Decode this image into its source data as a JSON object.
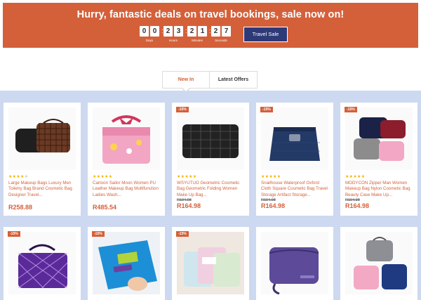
{
  "banner": {
    "title": "Hurry, fantastic deals on travel bookings, sale now on!",
    "countdown": {
      "days": [
        "0",
        "0"
      ],
      "hours": [
        "2",
        "3"
      ],
      "minutes": [
        "2",
        "1"
      ],
      "seconds": [
        "2",
        "7"
      ],
      "labels": {
        "days": "Days",
        "hours": "Hours",
        "minutes": "Minutes",
        "seconds": "Seconds"
      }
    },
    "cta_label": "Travel Sale"
  },
  "tabs": [
    {
      "label": "New In",
      "active": true
    },
    {
      "label": "Latest Offers",
      "active": false
    }
  ],
  "products": [
    {
      "title": "Large Makeup Bags Luxury Men Toiletry Bag Brand Cosmetic Bag Designer Travel...",
      "rating": 4,
      "old_price": "",
      "price": "R258.88",
      "badge": "",
      "icon": "brown-check-toiletry-bag"
    },
    {
      "title": "Cartoon Sailor Moon Women PU Leather Makeup Bag Multifunction Ladies Wash...",
      "rating": 5,
      "old_price": "",
      "price": "R485.54",
      "badge": "",
      "icon": "pink-vanity-case"
    },
    {
      "title": "WSYUTUO Geometric Cosmetic Bag Geometric Folding Women Make Up Bag...",
      "rating": 5,
      "old_price": "R194.98",
      "price": "R164.98",
      "badge": "-15%",
      "icon": "black-geometric-bag"
    },
    {
      "title": "Snailhouse Waterproof Oxford Cloth Square Cosmetic Bag Travel Storage Artifact Storage...",
      "rating": 5,
      "old_price": "R194.98",
      "price": "R164.98",
      "badge": "-15%",
      "icon": "navy-square-bag"
    },
    {
      "title": "MODYCON Zipper Man Women Makeup Bag Nylon Cosmetic Bag Beauty Case Make Up...",
      "rating": 5,
      "old_price": "R194.98",
      "price": "R164.98",
      "badge": "-15%",
      "icon": "multicolor-bag-set"
    },
    {
      "title": "",
      "rating": 0,
      "old_price": "",
      "price": "",
      "badge": "-15%",
      "icon": "purple-geometric-case"
    },
    {
      "title": "",
      "rating": 0,
      "old_price": "",
      "price": "",
      "badge": "-15%",
      "icon": "blue-passport-wallet"
    },
    {
      "title": "",
      "rating": 0,
      "old_price": "",
      "price": "",
      "badge": "-15%",
      "icon": "pastel-travel-wallets"
    },
    {
      "title": "",
      "rating": 0,
      "old_price": "",
      "price": "",
      "badge": "",
      "icon": "purple-travel-wallet"
    },
    {
      "title": "",
      "rating": 0,
      "old_price": "",
      "price": "",
      "badge": "",
      "icon": "organizer-bag-set"
    }
  ],
  "colors": {
    "accent": "#d4603a",
    "cta": "#2e3a78",
    "grid_background": "#cdd9f0",
    "stars": "#f0b400"
  }
}
